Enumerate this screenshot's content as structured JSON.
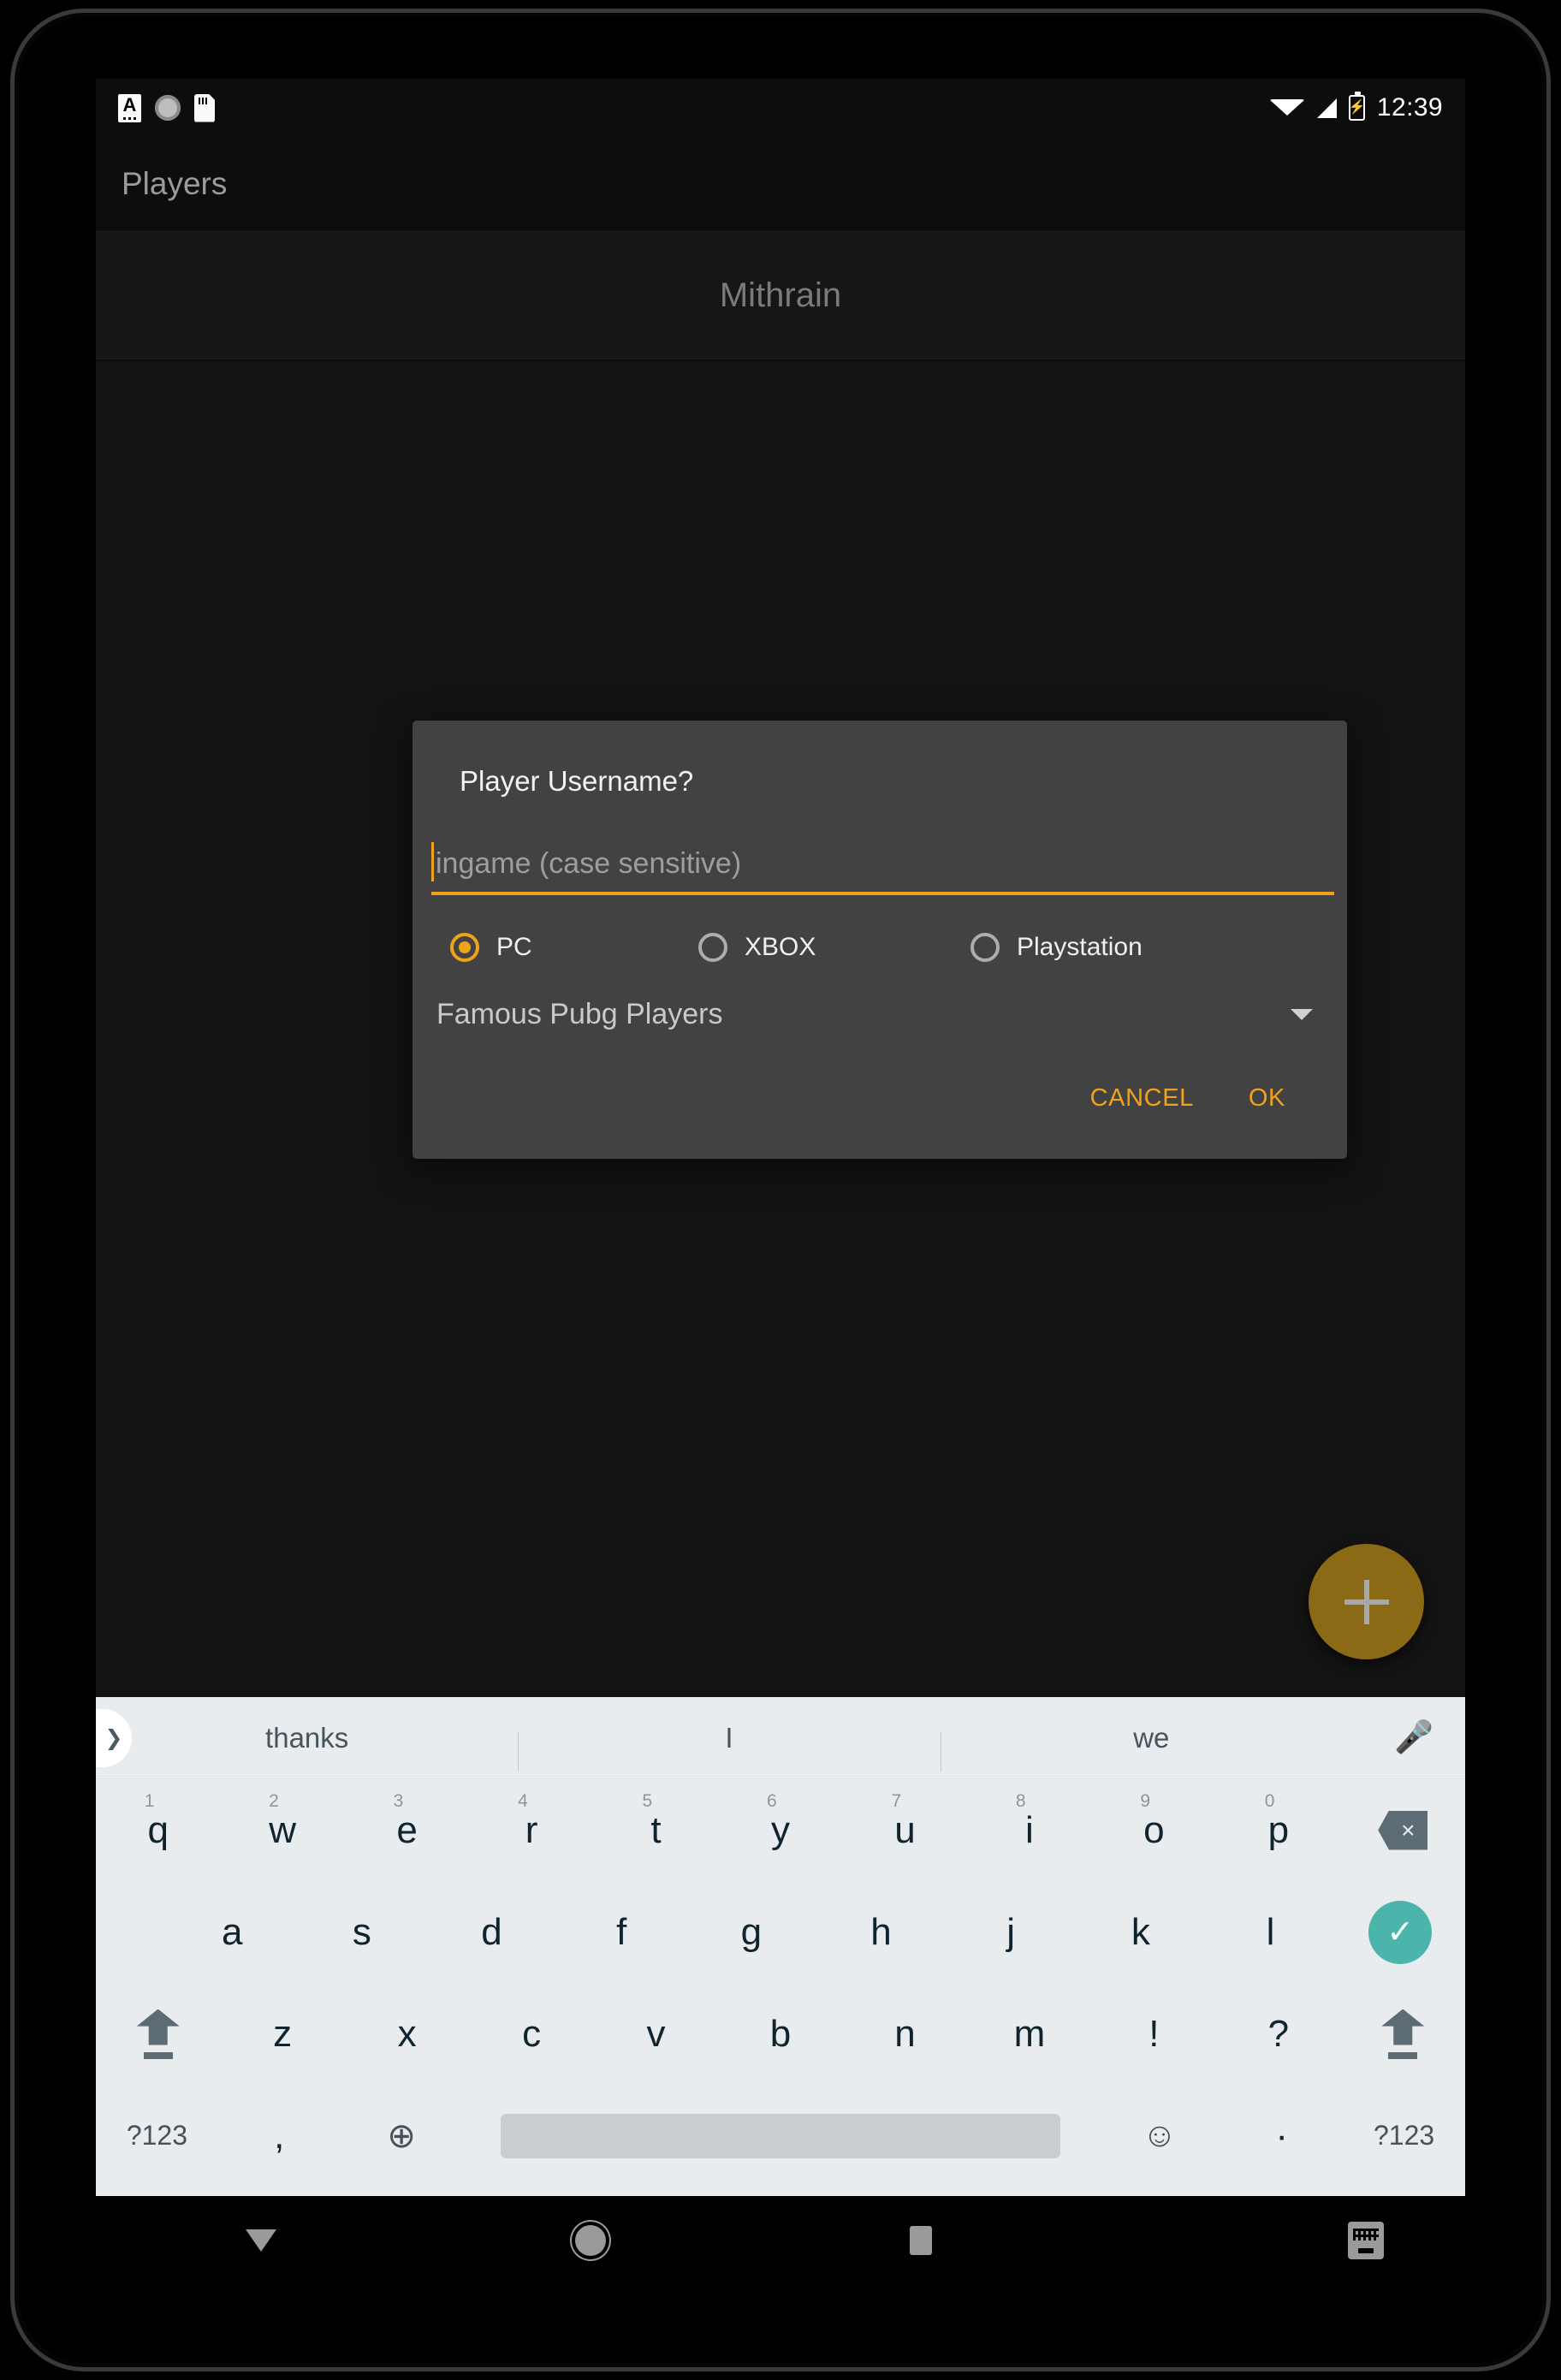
{
  "status_bar": {
    "time": "12:39",
    "left_icons": [
      "letter-a-icon",
      "sync-circle-icon",
      "sd-card-icon"
    ],
    "right_icons": [
      "wifi-icon",
      "cell-signal-icon",
      "battery-charging-icon"
    ]
  },
  "app_bar": {
    "title": "Players"
  },
  "tabs": [
    {
      "label": "Mithrain"
    }
  ],
  "fab": {
    "icon": "plus-icon",
    "color": "#8a6a15"
  },
  "dialog": {
    "title": "Player Username?",
    "input": {
      "value": "",
      "placeholder": "ingame (case sensitive)"
    },
    "platforms": [
      {
        "label": "PC",
        "selected": true
      },
      {
        "label": "XBOX",
        "selected": false
      },
      {
        "label": "Playstation",
        "selected": false
      }
    ],
    "spinner": {
      "value": "Famous Pubg Players"
    },
    "buttons": {
      "cancel": "CANCEL",
      "ok": "OK"
    },
    "accent": "#efa31d",
    "surface": "#424242"
  },
  "keyboard": {
    "suggestions": [
      "thanks",
      "I",
      "we"
    ],
    "expand_icon": "chevron-right-icon",
    "mic_icon": "microphone-icon",
    "row1": [
      {
        "key": "q",
        "hint": "1"
      },
      {
        "key": "w",
        "hint": "2"
      },
      {
        "key": "e",
        "hint": "3"
      },
      {
        "key": "r",
        "hint": "4"
      },
      {
        "key": "t",
        "hint": "5"
      },
      {
        "key": "y",
        "hint": "6"
      },
      {
        "key": "u",
        "hint": "7"
      },
      {
        "key": "i",
        "hint": "8"
      },
      {
        "key": "o",
        "hint": "9"
      },
      {
        "key": "p",
        "hint": "0"
      }
    ],
    "backspace_glyph": "×",
    "row2": [
      "a",
      "s",
      "d",
      "f",
      "g",
      "h",
      "j",
      "k",
      "l"
    ],
    "enter_glyph": "✓",
    "row3": [
      "z",
      "x",
      "c",
      "v",
      "b",
      "n",
      "m",
      "!",
      "?"
    ],
    "row4": {
      "symbols_left": "?123",
      "comma": ",",
      "globe": "⊕",
      "emoji": "☺",
      "period": "·",
      "symbols_right": "?123"
    }
  },
  "nav_bar": {
    "back": "back-icon",
    "home": "home-icon",
    "recents": "recents-icon",
    "keyboard_switch": "keyboard-switch-icon"
  }
}
